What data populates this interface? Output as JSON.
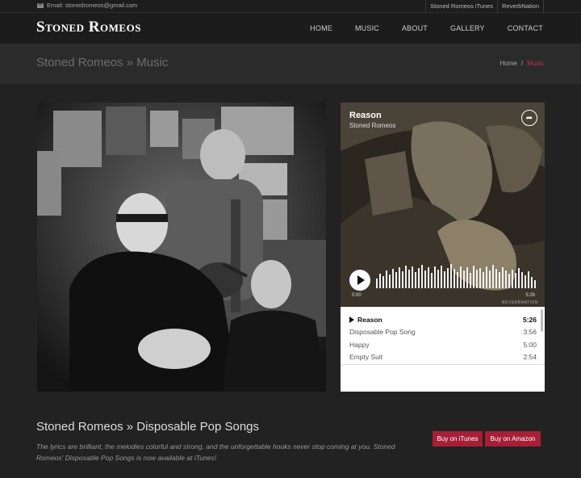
{
  "topbar": {
    "email": "Email: stonedromeos@gmail.com",
    "links": [
      "Stoned Romeos iTunes",
      "ReverbNation"
    ]
  },
  "header": {
    "logo": "Stoned Romeos",
    "nav": [
      "HOME",
      "MUSIC",
      "ABOUT",
      "GALLERY",
      "CONTACT"
    ]
  },
  "titlebar": {
    "title": "Stoned Romeos » Music",
    "breadcrumb_home": "Home",
    "breadcrumb_sep": "/",
    "breadcrumb_current": "Music"
  },
  "player": {
    "title": "Reason",
    "artist": "Stoned Romeos",
    "time_start": "0:00",
    "time_end": "5:26",
    "brand": "REVERBNATION",
    "tracks": [
      {
        "name": "Reason",
        "time": "5:26"
      },
      {
        "name": "Disposable Pop Song",
        "time": "3:56"
      },
      {
        "name": "Happy",
        "time": "5:00"
      },
      {
        "name": "Empty Suit",
        "time": "2:54"
      }
    ]
  },
  "album": {
    "title": "Stoned Romeos » Disposable Pop Songs",
    "description": "The lyrics are brilliant, the melodies colorful and strong, and the unforgettable hooks never stop coming at you. Stoned Romeos' Disposable Pop Songs is now available at iTunes!",
    "buy_itunes": "Buy on iTunes",
    "buy_amazon": "Buy on Amazon"
  },
  "colors": {
    "accent": "#a61f37",
    "breadcrumb_active": "#c92c4b",
    "background": "#222222"
  }
}
